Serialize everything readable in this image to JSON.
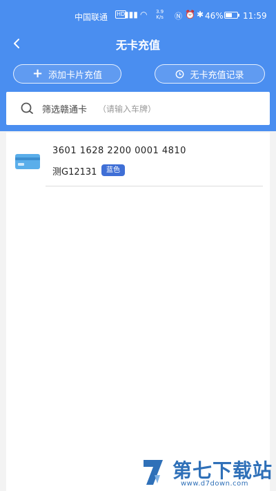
{
  "status_bar": {
    "carrier": "中国联通",
    "hd": "HD",
    "signal": "4G",
    "net_speed_value": "3.9",
    "net_speed_unit": "K/s",
    "battery_pct": "46%",
    "time": "11:59"
  },
  "header": {
    "title": "无卡充值"
  },
  "actions": {
    "add_card_label": "添加卡片充值",
    "record_label": "无卡充值记录"
  },
  "search": {
    "label": "筛选赣通卡",
    "hint": "（请输入车牌）"
  },
  "cards": [
    {
      "number": "3601 1628 2200 0001 4810",
      "plate": "测G12131",
      "plate_color": "蓝色"
    }
  ],
  "watermark": {
    "name": "第七下载站",
    "url": "www.d7down.com"
  },
  "colors": {
    "header_blue": "#4a8ef0",
    "badge_blue": "#3f6fd6",
    "card_icon_blue": "#5aaeea"
  }
}
